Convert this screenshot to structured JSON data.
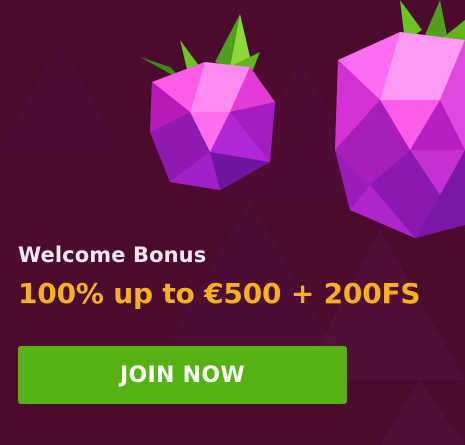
{
  "banner": {
    "eyebrow": "Welcome Bonus",
    "headline": "100% up to €500 + 200FS",
    "cta_label": "JOIN NOW"
  },
  "colors": {
    "background": "#4a0b2e",
    "headline": "#f7b21b",
    "cta": "#56b212",
    "gem_pink": "#f23fd8",
    "gem_purple": "#9a1fd0",
    "leaf_green": "#5fb61e"
  },
  "icons": [
    "raspberry-gem-small-icon",
    "raspberry-gem-large-icon"
  ]
}
